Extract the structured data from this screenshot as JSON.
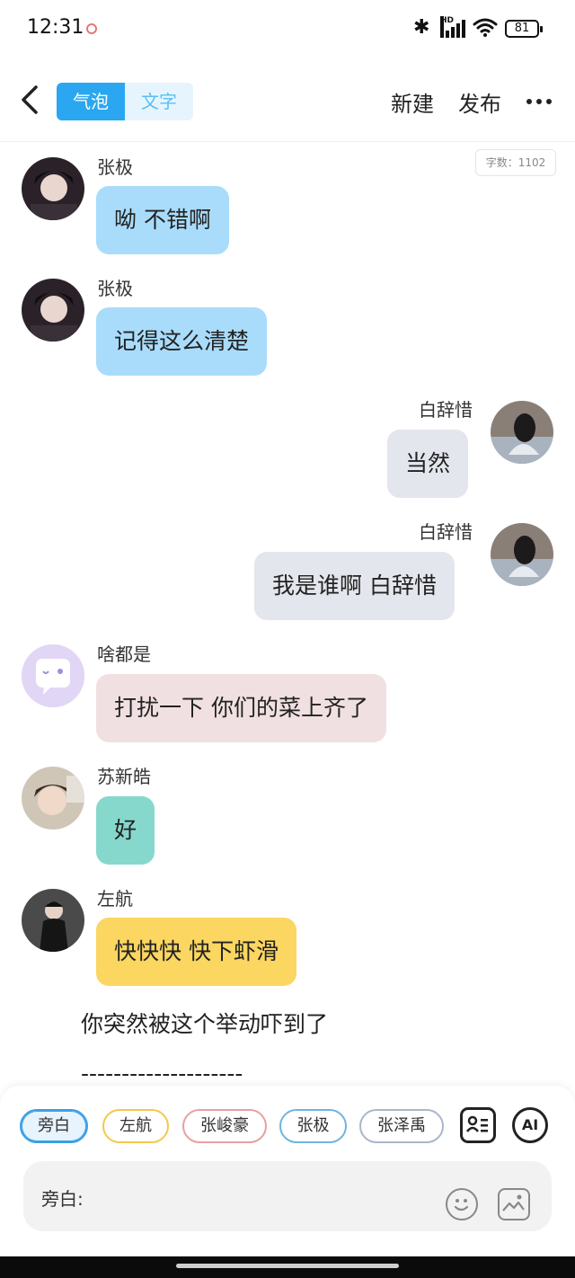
{
  "status_bar": {
    "time": "12:31",
    "battery": "81",
    "signal_label": "HD"
  },
  "header": {
    "mode_tabs": [
      {
        "label": "气泡",
        "active": true
      },
      {
        "label": "文字",
        "active": false
      }
    ],
    "new_label": "新建",
    "publish_label": "发布",
    "word_count": "字数：1102"
  },
  "messages": [
    {
      "side": "left",
      "sender": "张极",
      "text": "呦 不错啊",
      "bubble_color": "#a9dcfb",
      "avatar": "portrait-dark"
    },
    {
      "side": "left",
      "sender": "张极",
      "text": "记得这么清楚",
      "bubble_color": "#a9dcfb",
      "avatar": "portrait-dark"
    },
    {
      "side": "right",
      "sender": "白辞惜",
      "text": "当然",
      "bubble_color": "#e3e6ec",
      "avatar": "portrait-night"
    },
    {
      "side": "right",
      "sender": "白辞惜",
      "text": "我是谁啊 白辞惜",
      "bubble_color": "#e3e6ec",
      "avatar": "portrait-night"
    },
    {
      "side": "left",
      "sender": "啥都是",
      "text": "打扰一下 你们的菜上齐了",
      "bubble_color": "#f1e0e2",
      "avatar": "chat-bubble-icon"
    },
    {
      "side": "left",
      "sender": "苏新皓",
      "text": "好",
      "bubble_color": "#86d8cc",
      "avatar": "portrait-light"
    },
    {
      "side": "left",
      "sender": "左航",
      "text": "快快快 快下虾滑",
      "bubble_color": "#fbd661",
      "avatar": "portrait-dark-jacket"
    }
  ],
  "narration": "你突然被这个举动吓到了",
  "separator": "--------------------",
  "characters": [
    {
      "label": "旁白",
      "border": "#3b9fe6",
      "active": true
    },
    {
      "label": "左航",
      "border": "#f2c94c",
      "active": false
    },
    {
      "label": "张峻豪",
      "border": "#e8a0a0",
      "active": false
    },
    {
      "label": "张极",
      "border": "#6fb3e0",
      "active": false
    },
    {
      "label": "张泽禹",
      "border": "#a9b7c9",
      "active": false
    }
  ],
  "input": {
    "speaker_label": "旁白:"
  },
  "tools": {
    "ai_label": "AI"
  },
  "icons": [
    "back-arrow-icon",
    "more-icon",
    "character-card-icon",
    "ai-icon",
    "emoji-icon",
    "image-icon",
    "bluetooth-icon",
    "wifi-icon",
    "battery-icon"
  ]
}
